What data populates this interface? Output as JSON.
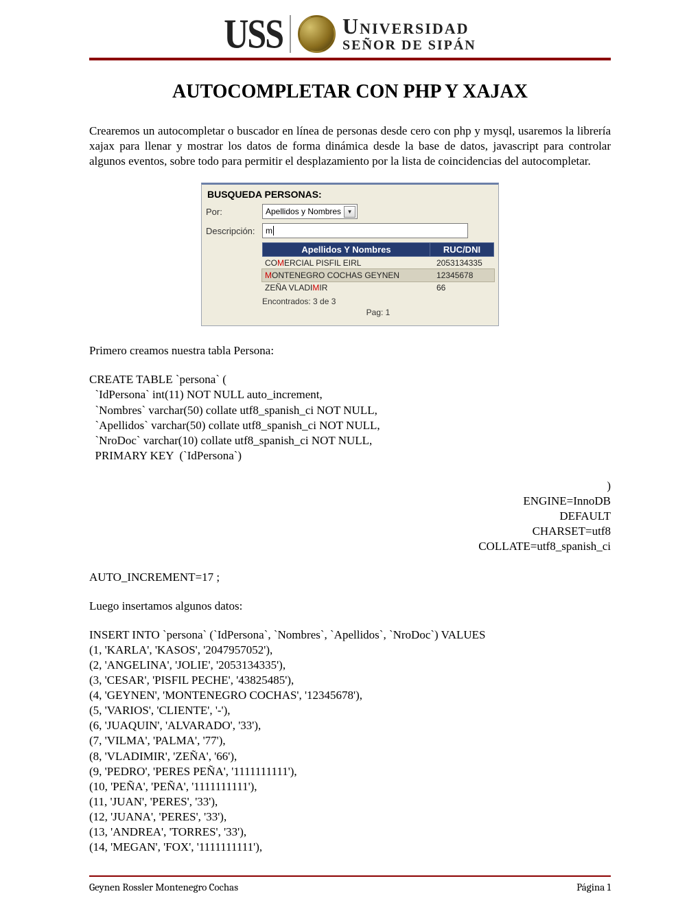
{
  "header": {
    "uss": "USS",
    "uni_top": "Universidad",
    "uni_bottom": "SEÑOR DE SIPÁN"
  },
  "title": "AUTOCOMPLETAR CON PHP Y XAJAX",
  "intro": "Crearemos un autocompletar o buscador en línea de personas desde cero con php y mysql, usaremos la librería xajax para llenar y mostrar los datos de forma dinámica desde la base de datos, javascript para controlar algunos eventos, sobre todo para permitir el desplazamiento por la lista de coincidencias del autocompletar.",
  "panel": {
    "heading": "BUSQUEDA PERSONAS:",
    "por_label": "Por:",
    "por_value": "Apellidos y Nombres",
    "desc_label": "Descripción:",
    "desc_value": "m",
    "th_nombre": "Apellidos Y Nombres",
    "th_doc": "RUC/DNI",
    "rows": [
      {
        "pre": "CO",
        "hl": "M",
        "post": "ERCIAL PISFIL EIRL",
        "doc": "2053134335"
      },
      {
        "pre": "",
        "hl": "M",
        "post": "ONTENEGRO COCHAS GEYNEN",
        "doc": "12345678"
      },
      {
        "pre": "ZEÑA VLADI",
        "hl": "M",
        "post": "IR",
        "doc": "66"
      }
    ],
    "found": "Encontrados: 3 de 3",
    "pag": "Pag: 1"
  },
  "text_table": "Primero creamos nuestra tabla Persona:",
  "sql_create_top": "CREATE TABLE `persona` (\n  `IdPersona` int(11) NOT NULL auto_increment,\n  `Nombres` varchar(50) collate utf8_spanish_ci NOT NULL,\n  `Apellidos` varchar(50) collate utf8_spanish_ci NOT NULL,\n  `NroDoc` varchar(10) collate utf8_spanish_ci NOT NULL,\n  PRIMARY KEY  (`IdPersona`)",
  "sql_create_line_parts": {
    "p1": ")",
    "p2": "ENGINE=InnoDB",
    "p3": "DEFAULT",
    "p4": "CHARSET=utf8",
    "p5": "COLLATE=utf8_spanish_ci"
  },
  "sql_create_last": "AUTO_INCREMENT=17 ;",
  "text_insert": "Luego insertamos algunos datos:",
  "sql_insert": "INSERT INTO `persona` (`IdPersona`, `Nombres`, `Apellidos`, `NroDoc`) VALUES\n(1, 'KARLA', 'KASOS', '2047957052'),\n(2, 'ANGELINA', 'JOLIE', '2053134335'),\n(3, 'CESAR', 'PISFIL PECHE', '43825485'),\n(4, 'GEYNEN', 'MONTENEGRO COCHAS', '12345678'),\n(5, 'VARIOS', 'CLIENTE', '-'),\n(6, 'JUAQUIN', 'ALVARADO', '33'),\n(7, 'VILMA', 'PALMA', '77'),\n(8, 'VLADIMIR', 'ZEÑA', '66'),\n(9, 'PEDRO', 'PERES PEÑA', '1111111111'),\n(10, 'PEÑA', 'PEÑA', '1111111111'),\n(11, 'JUAN', 'PERES', '33'),\n(12, 'JUANA', 'PERES', '33'),\n(13, 'ANDREA', 'TORRES', '33'),\n(14, 'MEGAN', 'FOX', '1111111111'),",
  "footer": {
    "author": "Geynen Rossler Montenegro Cochas",
    "page": "Página 1"
  }
}
